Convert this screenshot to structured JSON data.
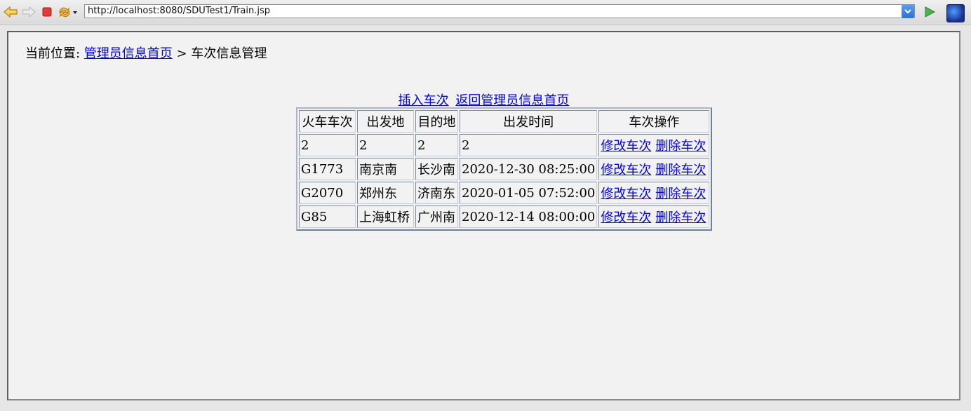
{
  "browser": {
    "url": "http://localhost:8080/SDUTest1/Train.jsp"
  },
  "breadcrumb": {
    "prefix": "当前位置:",
    "home_link": "管理员信息首页",
    "separator": ">",
    "current": "车次信息管理"
  },
  "actions": {
    "insert": "插入车次",
    "back": "返回管理员信息首页"
  },
  "table": {
    "headers": [
      "火车车次",
      "出发地",
      "目的地",
      "出发时间",
      "车次操作"
    ],
    "edit_label": "修改车次",
    "delete_label": "删除车次",
    "rows": [
      {
        "no": "2",
        "from": "2",
        "to": "2",
        "time": "2"
      },
      {
        "no": "G1773",
        "from": "南京南",
        "to": "长沙南",
        "time": "2020-12-30 08:25:00"
      },
      {
        "no": "G2070",
        "from": "郑州东",
        "to": "济南东",
        "time": "2020-01-05 07:52:00"
      },
      {
        "no": "G85",
        "from": "上海虹桥",
        "to": "广州南",
        "time": "2020-12-14 08:00:00"
      }
    ]
  },
  "colors": {
    "link": "#0000ee",
    "back_arrow": "#e2a21a",
    "stop": "#d92b2b",
    "go": "#3aa845"
  }
}
